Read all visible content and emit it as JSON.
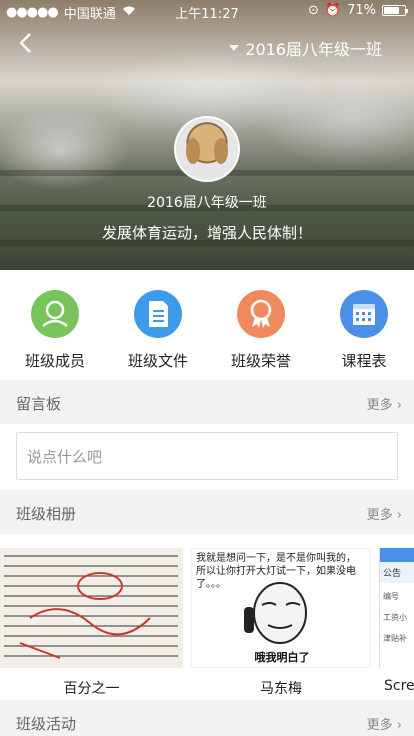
{
  "status_bar": {
    "carrier": "中国联通",
    "time": "上午11:27",
    "battery": "71%"
  },
  "nav": {
    "title": "2016届八年级一班"
  },
  "hero": {
    "name": "2016届八年级一班",
    "motto": "发展体育运动，增强人民体制！"
  },
  "functions": [
    {
      "label": "班级成员",
      "color": "#78c45a"
    },
    {
      "label": "班级文件",
      "color": "#3d9be9"
    },
    {
      "label": "班级荣誉",
      "color": "#f08a5d"
    },
    {
      "label": "课程表",
      "color": "#4a8fe8"
    }
  ],
  "message_board": {
    "title": "留言板",
    "more": "更多",
    "placeholder": "说点什么吧"
  },
  "album": {
    "title": "班级相册",
    "more": "更多",
    "items": [
      {
        "caption": "百分之一"
      },
      {
        "caption": "马东梅"
      },
      {
        "caption": "Scre"
      }
    ],
    "meme_top": "我就是想问一下，是不是你叫我的，\n所以让你打开大灯试一下，如果没电了。。。",
    "meme_bottom": "哦我明白了",
    "side_labels": [
      "公告",
      "编号",
      "工资小",
      "津贴补"
    ]
  },
  "activity": {
    "title": "班级活动",
    "more": "更多"
  }
}
